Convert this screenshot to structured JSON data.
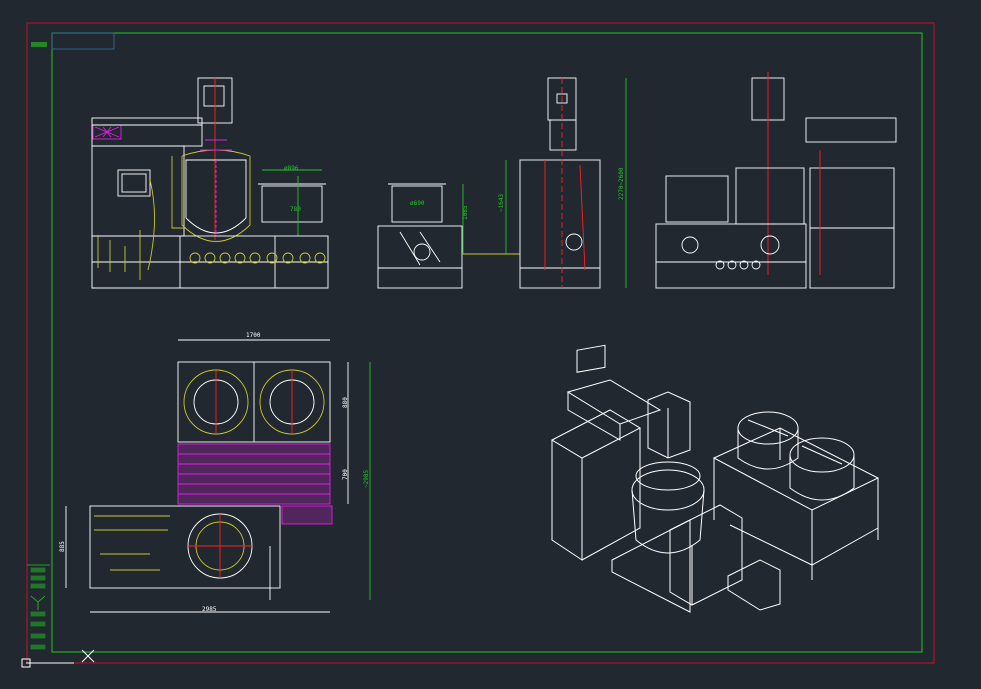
{
  "colors": {
    "background": "#212830",
    "outer_frame": "#c8102e",
    "inner_frame": "#22c522",
    "white_lines": "#ffffff",
    "yellow_lines": "#c8c832",
    "magenta_lines": "#e020e0",
    "red_lines": "#ff2020",
    "green_lines": "#22c522"
  },
  "dimensions": {
    "top_width": "1700",
    "bottom_width": "2985",
    "right_upper": "880",
    "right_middle": "700",
    "right_total": "~2985",
    "left_lower": "885",
    "front_dia": "ø896",
    "front_h": "780",
    "side_w": "ø690",
    "side_h": "1085",
    "side2_h": "~1643",
    "side2_total": "2270~2600"
  },
  "views": [
    "front-elevation",
    "side-elevation",
    "rear-elevation",
    "plan-view",
    "isometric-view"
  ]
}
